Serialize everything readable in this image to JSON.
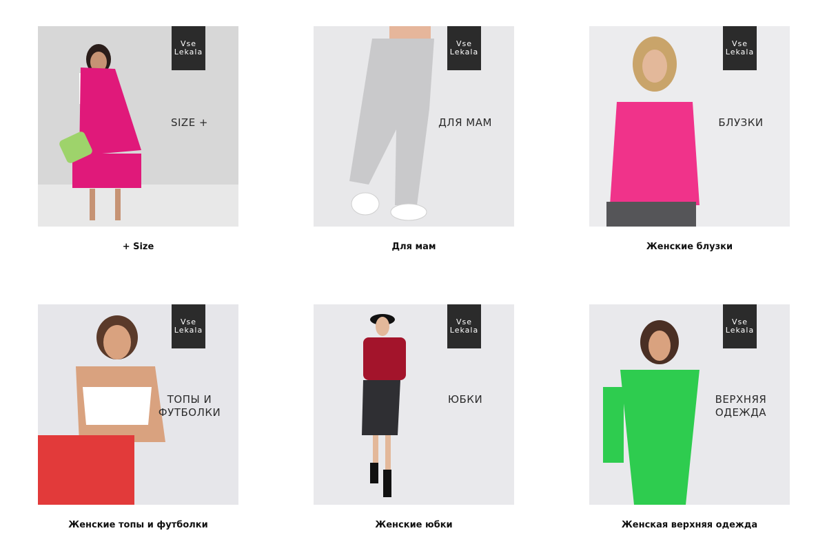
{
  "brand_logo": {
    "line1": "Vse",
    "line2": "Lekala"
  },
  "categories": [
    {
      "overlay": "SIZE +",
      "caption": "+ Size",
      "bg": "#dedede"
    },
    {
      "overlay": "ДЛЯ МАМ",
      "caption": "Для мам",
      "bg": "#e8e8ea"
    },
    {
      "overlay": "БЛУЗКИ",
      "caption": "Женские блузки",
      "bg": "#ececee"
    },
    {
      "overlay": "ТОПЫ И ФУТБОЛКИ",
      "caption": "Женские топы и футболки",
      "bg": "#e6e6ea"
    },
    {
      "overlay": "ЮБКИ",
      "caption": "Женские юбки",
      "bg": "#e9e9ec"
    },
    {
      "overlay": "ВЕРХНЯЯ ОДЕЖДА",
      "caption": "Женская верхняя одежда",
      "bg": "#e9e9ec"
    }
  ],
  "colors": {
    "magenta": "#e0197a",
    "pink_blouse": "#f0338a",
    "red_top": "#a3142b",
    "green_coat": "#2ecc4f",
    "grey_pants": "#c9c9cb"
  }
}
